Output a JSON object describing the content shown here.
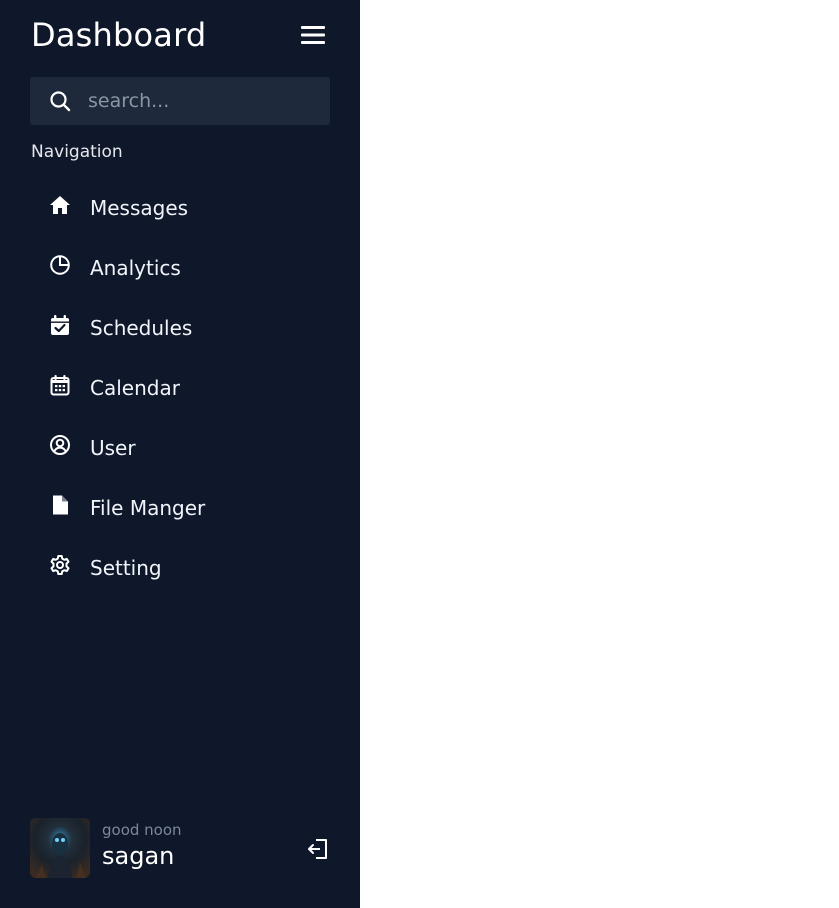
{
  "sidebar": {
    "title": "Dashboard",
    "search": {
      "placeholder": "search...",
      "value": ""
    },
    "nav_heading": "Navigation",
    "items": [
      {
        "label": "Messages",
        "icon": "home-icon"
      },
      {
        "label": "Analytics",
        "icon": "pie-chart-icon"
      },
      {
        "label": "Schedules",
        "icon": "calendar-check-icon"
      },
      {
        "label": "Calendar",
        "icon": "calendar-icon"
      },
      {
        "label": "User",
        "icon": "user-circle-icon"
      },
      {
        "label": "File Manger",
        "icon": "file-icon"
      },
      {
        "label": "Setting",
        "icon": "gear-icon"
      }
    ],
    "profile": {
      "greeting": "good noon",
      "name": "sagan"
    }
  },
  "colors": {
    "sidebar_bg": "#0f172a",
    "search_bg": "#1e293b",
    "text": "#ffffff",
    "muted": "#7c8797",
    "main_bg": "#ffffff"
  }
}
